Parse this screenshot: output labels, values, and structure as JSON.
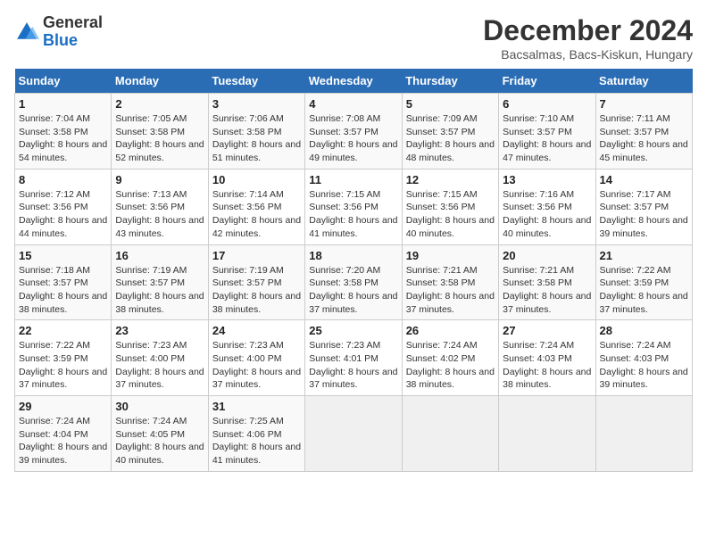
{
  "logo": {
    "text_general": "General",
    "text_blue": "Blue"
  },
  "header": {
    "month_year": "December 2024",
    "location": "Bacsalmas, Bacs-Kiskun, Hungary"
  },
  "weekdays": [
    "Sunday",
    "Monday",
    "Tuesday",
    "Wednesday",
    "Thursday",
    "Friday",
    "Saturday"
  ],
  "days": [
    {
      "num": "",
      "info": ""
    },
    {
      "num": "",
      "info": ""
    },
    {
      "num": "",
      "info": ""
    },
    {
      "num": "",
      "info": ""
    },
    {
      "num": "",
      "info": ""
    },
    {
      "num": "",
      "info": ""
    },
    {
      "num": "",
      "info": ""
    },
    {
      "num": "1",
      "sunrise": "Sunrise: 7:04 AM",
      "sunset": "Sunset: 3:58 PM",
      "daylight": "Daylight: 8 hours and 54 minutes."
    },
    {
      "num": "2",
      "sunrise": "Sunrise: 7:05 AM",
      "sunset": "Sunset: 3:58 PM",
      "daylight": "Daylight: 8 hours and 52 minutes."
    },
    {
      "num": "3",
      "sunrise": "Sunrise: 7:06 AM",
      "sunset": "Sunset: 3:58 PM",
      "daylight": "Daylight: 8 hours and 51 minutes."
    },
    {
      "num": "4",
      "sunrise": "Sunrise: 7:08 AM",
      "sunset": "Sunset: 3:57 PM",
      "daylight": "Daylight: 8 hours and 49 minutes."
    },
    {
      "num": "5",
      "sunrise": "Sunrise: 7:09 AM",
      "sunset": "Sunset: 3:57 PM",
      "daylight": "Daylight: 8 hours and 48 minutes."
    },
    {
      "num": "6",
      "sunrise": "Sunrise: 7:10 AM",
      "sunset": "Sunset: 3:57 PM",
      "daylight": "Daylight: 8 hours and 47 minutes."
    },
    {
      "num": "7",
      "sunrise": "Sunrise: 7:11 AM",
      "sunset": "Sunset: 3:57 PM",
      "daylight": "Daylight: 8 hours and 45 minutes."
    },
    {
      "num": "8",
      "sunrise": "Sunrise: 7:12 AM",
      "sunset": "Sunset: 3:56 PM",
      "daylight": "Daylight: 8 hours and 44 minutes."
    },
    {
      "num": "9",
      "sunrise": "Sunrise: 7:13 AM",
      "sunset": "Sunset: 3:56 PM",
      "daylight": "Daylight: 8 hours and 43 minutes."
    },
    {
      "num": "10",
      "sunrise": "Sunrise: 7:14 AM",
      "sunset": "Sunset: 3:56 PM",
      "daylight": "Daylight: 8 hours and 42 minutes."
    },
    {
      "num": "11",
      "sunrise": "Sunrise: 7:15 AM",
      "sunset": "Sunset: 3:56 PM",
      "daylight": "Daylight: 8 hours and 41 minutes."
    },
    {
      "num": "12",
      "sunrise": "Sunrise: 7:15 AM",
      "sunset": "Sunset: 3:56 PM",
      "daylight": "Daylight: 8 hours and 40 minutes."
    },
    {
      "num": "13",
      "sunrise": "Sunrise: 7:16 AM",
      "sunset": "Sunset: 3:56 PM",
      "daylight": "Daylight: 8 hours and 40 minutes."
    },
    {
      "num": "14",
      "sunrise": "Sunrise: 7:17 AM",
      "sunset": "Sunset: 3:57 PM",
      "daylight": "Daylight: 8 hours and 39 minutes."
    },
    {
      "num": "15",
      "sunrise": "Sunrise: 7:18 AM",
      "sunset": "Sunset: 3:57 PM",
      "daylight": "Daylight: 8 hours and 38 minutes."
    },
    {
      "num": "16",
      "sunrise": "Sunrise: 7:19 AM",
      "sunset": "Sunset: 3:57 PM",
      "daylight": "Daylight: 8 hours and 38 minutes."
    },
    {
      "num": "17",
      "sunrise": "Sunrise: 7:19 AM",
      "sunset": "Sunset: 3:57 PM",
      "daylight": "Daylight: 8 hours and 38 minutes."
    },
    {
      "num": "18",
      "sunrise": "Sunrise: 7:20 AM",
      "sunset": "Sunset: 3:58 PM",
      "daylight": "Daylight: 8 hours and 37 minutes."
    },
    {
      "num": "19",
      "sunrise": "Sunrise: 7:21 AM",
      "sunset": "Sunset: 3:58 PM",
      "daylight": "Daylight: 8 hours and 37 minutes."
    },
    {
      "num": "20",
      "sunrise": "Sunrise: 7:21 AM",
      "sunset": "Sunset: 3:58 PM",
      "daylight": "Daylight: 8 hours and 37 minutes."
    },
    {
      "num": "21",
      "sunrise": "Sunrise: 7:22 AM",
      "sunset": "Sunset: 3:59 PM",
      "daylight": "Daylight: 8 hours and 37 minutes."
    },
    {
      "num": "22",
      "sunrise": "Sunrise: 7:22 AM",
      "sunset": "Sunset: 3:59 PM",
      "daylight": "Daylight: 8 hours and 37 minutes."
    },
    {
      "num": "23",
      "sunrise": "Sunrise: 7:23 AM",
      "sunset": "Sunset: 4:00 PM",
      "daylight": "Daylight: 8 hours and 37 minutes."
    },
    {
      "num": "24",
      "sunrise": "Sunrise: 7:23 AM",
      "sunset": "Sunset: 4:00 PM",
      "daylight": "Daylight: 8 hours and 37 minutes."
    },
    {
      "num": "25",
      "sunrise": "Sunrise: 7:23 AM",
      "sunset": "Sunset: 4:01 PM",
      "daylight": "Daylight: 8 hours and 37 minutes."
    },
    {
      "num": "26",
      "sunrise": "Sunrise: 7:24 AM",
      "sunset": "Sunset: 4:02 PM",
      "daylight": "Daylight: 8 hours and 38 minutes."
    },
    {
      "num": "27",
      "sunrise": "Sunrise: 7:24 AM",
      "sunset": "Sunset: 4:03 PM",
      "daylight": "Daylight: 8 hours and 38 minutes."
    },
    {
      "num": "28",
      "sunrise": "Sunrise: 7:24 AM",
      "sunset": "Sunset: 4:03 PM",
      "daylight": "Daylight: 8 hours and 39 minutes."
    },
    {
      "num": "29",
      "sunrise": "Sunrise: 7:24 AM",
      "sunset": "Sunset: 4:04 PM",
      "daylight": "Daylight: 8 hours and 39 minutes."
    },
    {
      "num": "30",
      "sunrise": "Sunrise: 7:24 AM",
      "sunset": "Sunset: 4:05 PM",
      "daylight": "Daylight: 8 hours and 40 minutes."
    },
    {
      "num": "31",
      "sunrise": "Sunrise: 7:25 AM",
      "sunset": "Sunset: 4:06 PM",
      "daylight": "Daylight: 8 hours and 41 minutes."
    }
  ]
}
